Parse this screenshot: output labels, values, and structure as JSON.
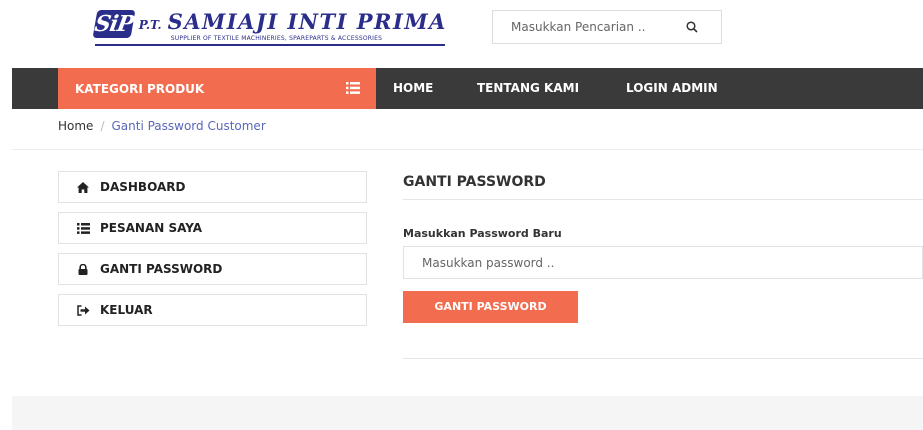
{
  "brand": {
    "logo_mark": "SiP",
    "prefix": "P.T.",
    "name": "SAMIAJI INTI PRIMA",
    "tagline": "SUPPLIER OF TEXTILE MACHINERIES, SPAREPARTS & ACCESSORIES",
    "color": "#2a2d8a"
  },
  "search": {
    "placeholder": "Masukkan Pencarian ..",
    "icon": "search-icon"
  },
  "nav": {
    "category_label": "KATEGORI PRODUK",
    "category_icon": "list-icon",
    "items": [
      "HOME",
      "TENTANG KAMI",
      "LOGIN ADMIN"
    ],
    "bar_color": "#3a3a3a",
    "accent_color": "#f26c4f"
  },
  "breadcrumb": {
    "home": "Home",
    "separator": "/",
    "current": "Ganti Password Customer"
  },
  "sidebar": {
    "items": [
      {
        "label": "DASHBOARD",
        "icon": "home-icon"
      },
      {
        "label": "PESANAN SAYA",
        "icon": "list-icon"
      },
      {
        "label": "GANTI PASSWORD",
        "icon": "lock-icon"
      },
      {
        "label": "KELUAR",
        "icon": "sign-out-icon"
      }
    ]
  },
  "main": {
    "title": "GANTI PASSWORD",
    "field_label": "Masukkan Password Baru",
    "field_placeholder": "Masukkan password ..",
    "submit_label": "GANTI PASSWORD"
  }
}
